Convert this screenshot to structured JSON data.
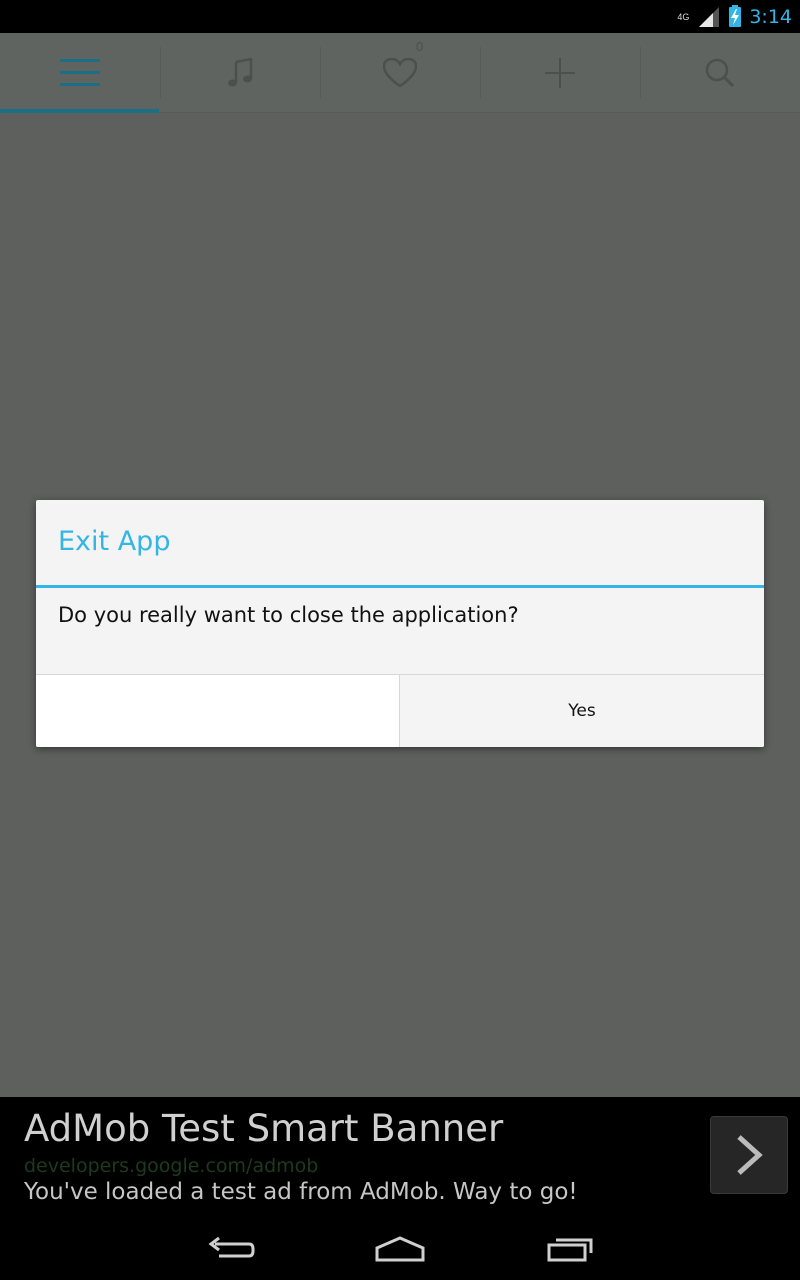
{
  "status_bar": {
    "network": "4G",
    "time": "3:14",
    "icons": [
      "signal-icon",
      "battery-charging-icon"
    ]
  },
  "tabs": [
    {
      "icon": "menu-icon",
      "active": true
    },
    {
      "icon": "music-note-icon",
      "active": false
    },
    {
      "icon": "heart-icon",
      "active": false,
      "badge": "0"
    },
    {
      "icon": "plus-icon",
      "active": false
    },
    {
      "icon": "search-icon",
      "active": false
    }
  ],
  "dialog": {
    "title": "Exit App",
    "message": "Do you really want to close the application?",
    "negative_label": "",
    "positive_label": "Yes"
  },
  "ad": {
    "title": "AdMob Test Smart Banner",
    "url": "developers.google.com/admob",
    "description": "You've loaded a test ad from AdMob. Way to go!",
    "arrow_icon": "chevron-right-icon"
  },
  "navbar": {
    "icons": [
      "back-icon",
      "home-icon",
      "recent-apps-icon"
    ]
  },
  "colors": {
    "accent": "#33b5e5",
    "scrim": "#5e605e",
    "dialog_bg": "#f4f4f4"
  }
}
